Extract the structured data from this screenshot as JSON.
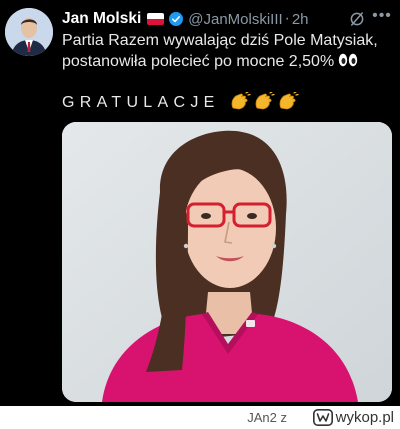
{
  "post": {
    "author_name": "Jan Molski",
    "handle": "@JanMolskiIII",
    "separator": "·",
    "time": "2h",
    "text": "Partia Razem wywalając dziś Pole Matysiak, postanowiła polecieć po mocne 2,50%",
    "emphasis": "GRATULACJE",
    "icons": [
      "poland-flag-icon",
      "verified-badge-icon",
      "grok-icon",
      "more-icon",
      "eyes-emoji-icon",
      "clapping-hands-emoji-icon"
    ]
  },
  "watermark": {
    "user": "JAn2",
    "user_separator": "z",
    "site": "wykop.pl"
  },
  "colors": {
    "background": "#000000",
    "text": "#e7e9ea",
    "muted": "#8b98a5",
    "verified": "#1d9bf0",
    "blouse": "#d8136f",
    "glasses": "#d41f2e"
  }
}
